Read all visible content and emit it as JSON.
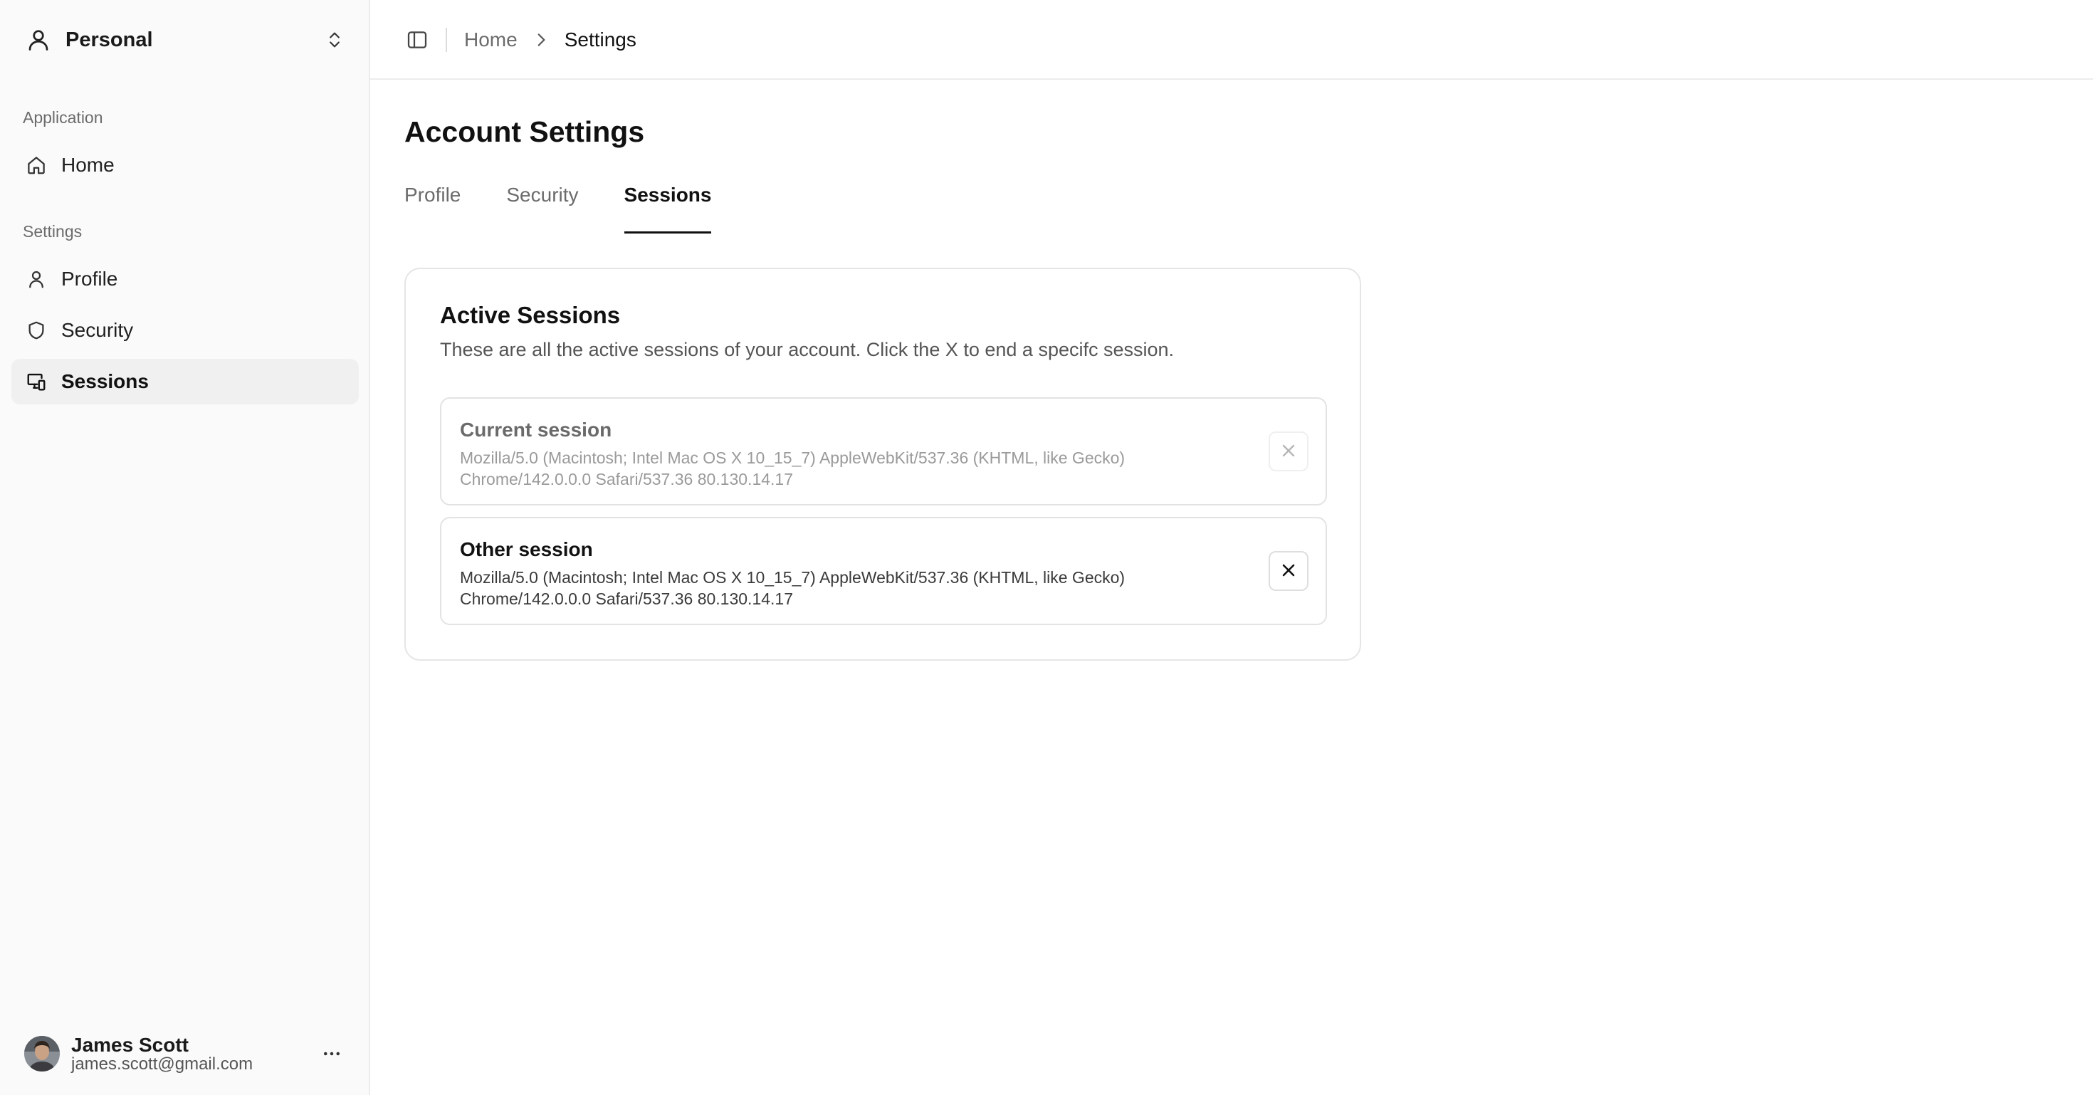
{
  "sidebar": {
    "workspace": {
      "name": "Personal",
      "icon": "user-icon",
      "switch_icon": "chevrons-up-down-icon"
    },
    "groups": [
      {
        "label": "Application",
        "items": [
          {
            "label": "Home",
            "icon": "home-icon",
            "active": false
          }
        ]
      },
      {
        "label": "Settings",
        "items": [
          {
            "label": "Profile",
            "icon": "user-icon",
            "active": false
          },
          {
            "label": "Security",
            "icon": "shield-icon",
            "active": false
          },
          {
            "label": "Sessions",
            "icon": "devices-icon",
            "active": true
          }
        ]
      }
    ],
    "user": {
      "name": "James Scott",
      "email": "james.scott@gmail.com",
      "more_icon": "ellipsis-icon"
    }
  },
  "topbar": {
    "toggle_icon": "sidebar-toggle-icon",
    "breadcrumb": [
      "Home",
      "Settings"
    ]
  },
  "main": {
    "title": "Account Settings",
    "tabs": [
      {
        "label": "Profile",
        "active": false
      },
      {
        "label": "Security",
        "active": false
      },
      {
        "label": "Sessions",
        "active": true
      }
    ],
    "card": {
      "title": "Active Sessions",
      "description": "These are all the active sessions of your account. Click the X to end a specifc session.",
      "sessions": [
        {
          "name": "Current session",
          "user_agent": "Mozilla/5.0 (Macintosh; Intel Mac OS X 10_15_7) AppleWebKit/537.36 (KHTML, like Gecko) Chrome/142.0.0.0 Safari/537.36 80.130.14.17",
          "disabled": true
        },
        {
          "name": "Other session",
          "user_agent": "Mozilla/5.0 (Macintosh; Intel Mac OS X 10_15_7) AppleWebKit/537.36 (KHTML, like Gecko) Chrome/142.0.0.0 Safari/537.36 80.130.14.17",
          "disabled": false
        }
      ]
    }
  },
  "colors": {
    "sidebar_bg": "#fafafa",
    "active_item_bg": "#f0f0f0",
    "border": "#e5e5e5",
    "text": "#111111",
    "muted": "#6b6b6b"
  }
}
